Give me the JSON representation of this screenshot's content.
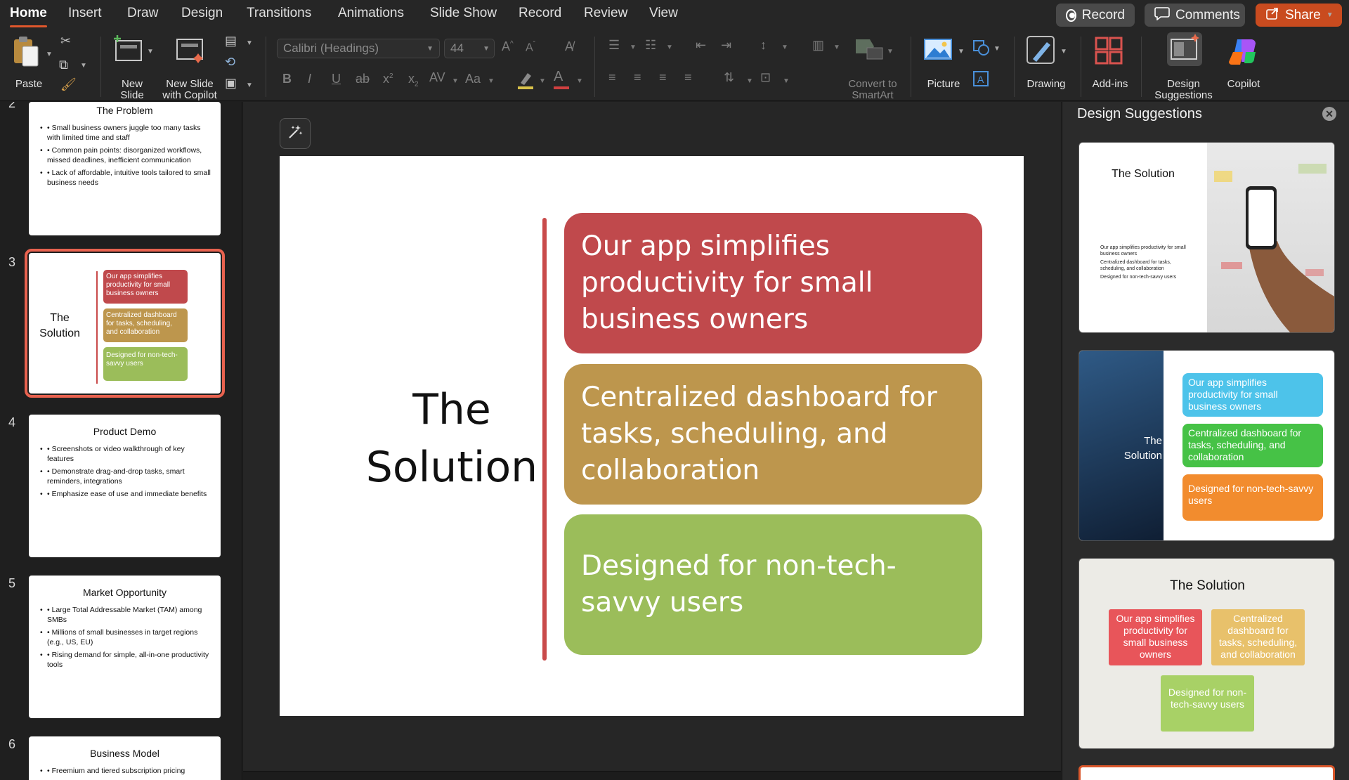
{
  "tabs": [
    "Home",
    "Insert",
    "Draw",
    "Design",
    "Transitions",
    "Animations",
    "Slide Show",
    "Record",
    "Review",
    "View"
  ],
  "active_tab": "Home",
  "top_buttons": {
    "record": "Record",
    "comments": "Comments",
    "share": "Share"
  },
  "ribbon": {
    "paste": "Paste",
    "new_slide_1": "New",
    "new_slide_2": "Slide",
    "new_copilot_1": "New Slide",
    "new_copilot_2": "with Copilot",
    "font_name": "Calibri (Headings)",
    "font_size": "44",
    "convert_1": "Convert to",
    "convert_2": "SmartArt",
    "picture": "Picture",
    "drawing": "Drawing",
    "addins": "Add-ins",
    "design_sugg_1": "Design",
    "design_sugg_2": "Suggestions",
    "copilot": "Copilot"
  },
  "thumbnails": {
    "s2": {
      "number": "2",
      "title": "The Problem",
      "bullets": [
        "• Small business owners juggle too many tasks with limited time and staff",
        "• Common pain points: disorganized workflows, missed deadlines, inefficient communication",
        "• Lack of affordable, intuitive tools tailored to small business needs"
      ]
    },
    "s3": {
      "number": "3",
      "title": "The Solution",
      "boxes": [
        "Our app simplifies productivity for small business owners",
        "Centralized dashboard for tasks, scheduling, and collaboration",
        "Designed for non-tech-savvy users"
      ]
    },
    "s4": {
      "number": "4",
      "title": "Product Demo",
      "bullets": [
        "• Screenshots or video walkthrough of key features",
        "• Demonstrate drag-and-drop tasks, smart reminders, integrations",
        "• Emphasize ease of use and immediate benefits"
      ]
    },
    "s5": {
      "number": "5",
      "title": "Market Opportunity",
      "bullets": [
        "• Large Total Addressable Market (TAM) among SMBs",
        "• Millions of small businesses in target regions (e.g., US, EU)",
        "• Rising demand for simple, all-in-one productivity tools"
      ]
    },
    "s6": {
      "number": "6",
      "title": "Business Model",
      "bullets": [
        "• Freemium and tiered subscription pricing"
      ]
    }
  },
  "slide": {
    "title": "The Solution",
    "boxes": [
      {
        "text": "Our app simplifies productivity for small business owners",
        "color": "#c0494c"
      },
      {
        "text": "Centralized dashboard for tasks, scheduling, and collaboration",
        "color": "#bd964d"
      },
      {
        "text": "Designed for non-tech-savvy users",
        "color": "#9bbd5a"
      }
    ],
    "accent_line_color": "#c94a4a"
  },
  "design_pane": {
    "title": "Design Suggestions",
    "card1": {
      "title": "The Solution",
      "bullets": [
        "Our app simplifies productivity for small business owners",
        "Centralized dashboard for tasks, scheduling, and collaboration",
        "Designed for non-tech-savvy users"
      ]
    },
    "card2": {
      "title": "The Solution",
      "boxes": [
        "Our app simplifies productivity for small business owners",
        "Centralized dashboard for tasks, scheduling, and collaboration",
        "Designed for non-tech-savvy users"
      ]
    },
    "card3": {
      "title": "The Solution",
      "boxes": [
        "Our app simplifies productivity for small business owners",
        "Centralized dashboard for tasks, scheduling, and collaboration",
        "Designed for non-tech-savvy users"
      ]
    }
  },
  "colors": {
    "accent": "#c94b1f",
    "selected_outline": "#e8624f"
  }
}
